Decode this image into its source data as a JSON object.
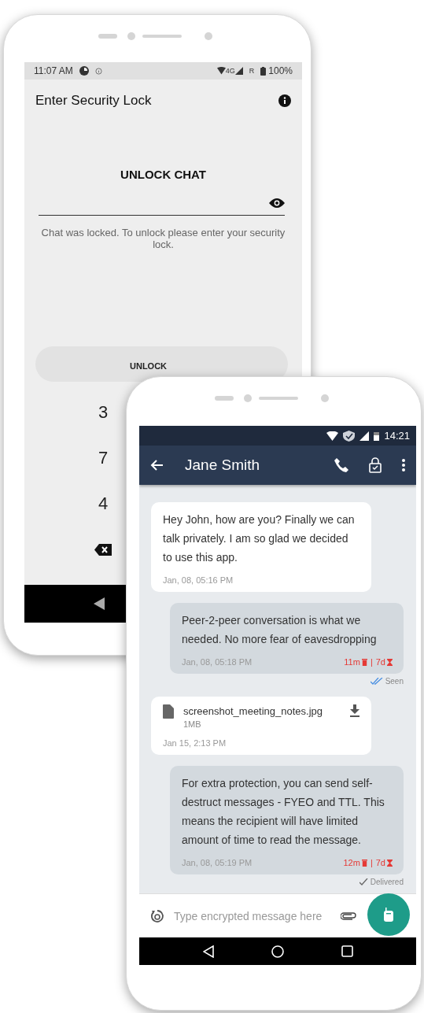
{
  "lock_phone": {
    "status_bar": {
      "time": "11:07 AM",
      "network": "4G",
      "roaming": "R",
      "battery": "100%"
    },
    "title": "Enter Security Lock",
    "heading": "UNLOCK CHAT",
    "hint": "Chat was locked. To unlock please enter your security lock.",
    "unlock_button": "UNLOCK",
    "keypad": [
      "3",
      "7",
      "4"
    ]
  },
  "chat_phone": {
    "status_bar": {
      "time": "14:21"
    },
    "title": "Jane Smith",
    "messages": [
      {
        "kind": "text",
        "outgoing": false,
        "text": "Hey John, how are you? Finally we can talk privately. I am so glad we decided to use this app.",
        "time": "Jan, 08, 05:16 PM"
      },
      {
        "kind": "text",
        "outgoing": true,
        "text": "Peer-2-peer conversation is what we needed. No more fear of eavesdropping",
        "time": "Jan, 08, 05:18 PM",
        "destruct": "11m",
        "separator": "|",
        "ttl": "7d",
        "status": "Seen",
        "read": true
      },
      {
        "kind": "file",
        "outgoing": false,
        "file_name": "screenshot_meeting_notes.jpg",
        "size": "1MB",
        "time": "Jan 15, 2:13 PM"
      },
      {
        "kind": "text",
        "outgoing": true,
        "text": "For extra protection, you can send self-destruct messages - FYEO and TTL. This means the recipient will have limited amount of time to read the message.",
        "time": "Jan, 08, 05:19 PM",
        "destruct": "12m",
        "separator": "|",
        "ttl": "7d",
        "status": "Delivered",
        "read": false
      }
    ],
    "composer": {
      "placeholder": "Type encrypted message here"
    }
  }
}
